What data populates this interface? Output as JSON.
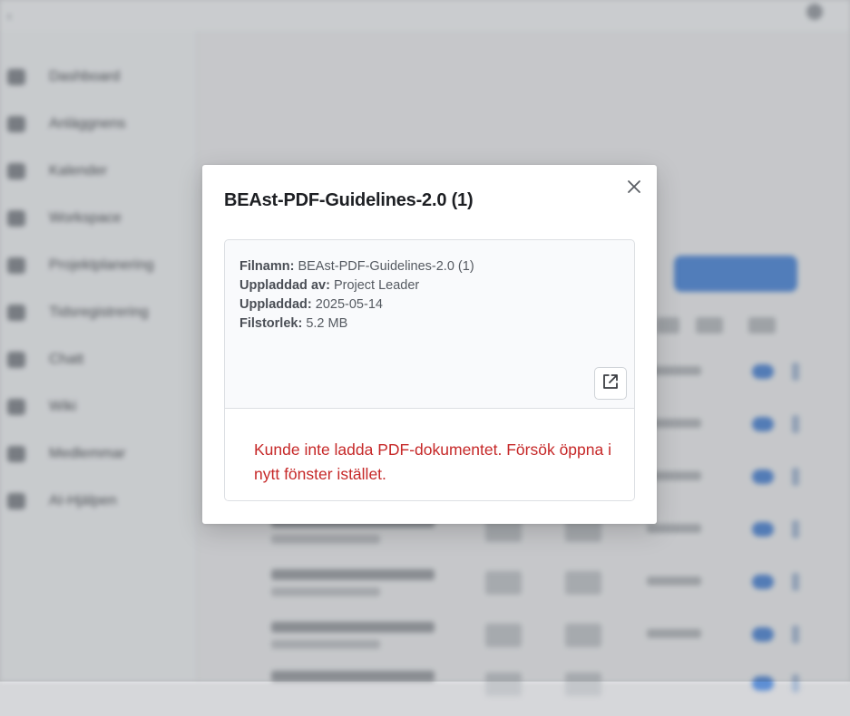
{
  "background": {
    "sidebar_items": [
      {
        "label": "Dashboard"
      },
      {
        "label": "Anläggnens"
      },
      {
        "label": "Kalender"
      },
      {
        "label": "Workspace"
      },
      {
        "label": "Projektplanering"
      },
      {
        "label": "Tidsregistrering"
      },
      {
        "label": "Chatt"
      },
      {
        "label": "Wiki"
      },
      {
        "label": "Medlemmar"
      },
      {
        "label": "AI-Hjälpen"
      }
    ]
  },
  "modal": {
    "title": "BEAst-PDF-Guidelines-2.0 (1)",
    "fields": [
      {
        "key": "Filnamn:",
        "value": "BEAst-PDF-Guidelines-2.0 (1)"
      },
      {
        "key": "Uppladdad av:",
        "value": "Project Leader"
      },
      {
        "key": "Uppladdad:",
        "value": "2025-05-14"
      },
      {
        "key": "Filstorlek:",
        "value": "5.2 MB"
      }
    ],
    "error_message": "Kunde inte ladda PDF-dokumentet. Försök öppna i nytt fönster istället.",
    "icons": {
      "close": "close-icon",
      "open_external": "external-link-icon"
    }
  }
}
